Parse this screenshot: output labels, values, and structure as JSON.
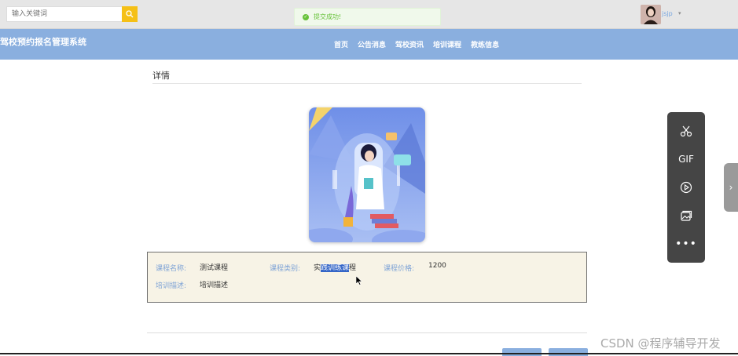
{
  "search": {
    "placeholder": "输入关键词"
  },
  "toast": {
    "message": "提交成功!"
  },
  "user": {
    "name": "jsjp"
  },
  "site": {
    "title": "驾校预约报名管理系统"
  },
  "nav": {
    "items": [
      "首页",
      "公告消息",
      "驾校资讯",
      "培训课程",
      "教练信息"
    ]
  },
  "detail": {
    "title": "详情",
    "course_name_label": "课程名称:",
    "course_name": "测试课程",
    "course_type_label": "课程类别:",
    "course_type_pre": "实",
    "course_type_selected": "践训练课",
    "course_type_post": "程",
    "course_price_label": "课程价格:",
    "course_price": "1200",
    "training_desc_label": "培训描述:",
    "training_desc": "培训描述"
  },
  "toolbar": {
    "gif_label": "GIF",
    "icons": [
      "scissors-icon",
      "gif-icon",
      "play-icon",
      "image-icon",
      "more-icon"
    ]
  },
  "watermark": {
    "text": "CSDN @程序辅导开发"
  },
  "colors": {
    "nav_bg": "#8aafdf",
    "accent": "#f5c016",
    "success": "#67c23a",
    "label": "#7ea3d6",
    "panel": "#f7f3e6"
  }
}
